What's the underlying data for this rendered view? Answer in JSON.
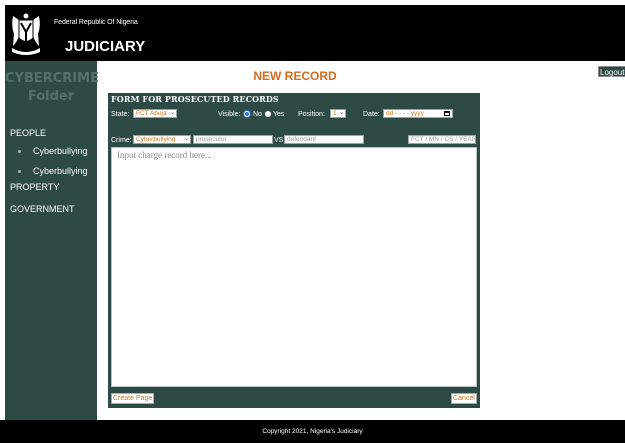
{
  "header": {
    "subtitle": "Federal Republic Of Nigeria",
    "title": "JUDICIARY"
  },
  "sidebar": {
    "title_line1": "CYBERCRIME",
    "title_line2": "Folder",
    "items": [
      {
        "label": "PEOPLE",
        "sub": false
      },
      {
        "label": "Cyberbullying",
        "sub": true
      },
      {
        "label": "Cyberbullying",
        "sub": true
      },
      {
        "label": "PROPERTY",
        "sub": false
      },
      {
        "label": "GOVERNMENT",
        "sub": false
      }
    ]
  },
  "topbar": {
    "logout_label": "Logout"
  },
  "main": {
    "page_title": "NEW RECORD",
    "form": {
      "title": "FORM FOR PROSECUTED RECORDS",
      "state_label": "State:",
      "state_value": "FCT Abuja",
      "visible_label": "Visible:",
      "visible_no": "No",
      "visible_yes": "Yes",
      "visible_selected": "No",
      "position_label": "Position:",
      "position_value": "1",
      "date_label": "Date:",
      "date_placeholder": "dd - - - - yyyy",
      "crime_label": "Crime:",
      "crime_value": "Cyberbullying",
      "prosecutor_placeholder": "prosecutor",
      "vs_label": "VS",
      "defendant_placeholder": "defendant",
      "case_ref_value": "FCT / MN / CS / YEAR",
      "charge_placeholder": "Input charge record here...",
      "create_label": "Create Page",
      "cancel_label": "Cancel"
    }
  },
  "footer": {
    "copyright": "Copyright 2021, Nigeria's Judiciary"
  }
}
